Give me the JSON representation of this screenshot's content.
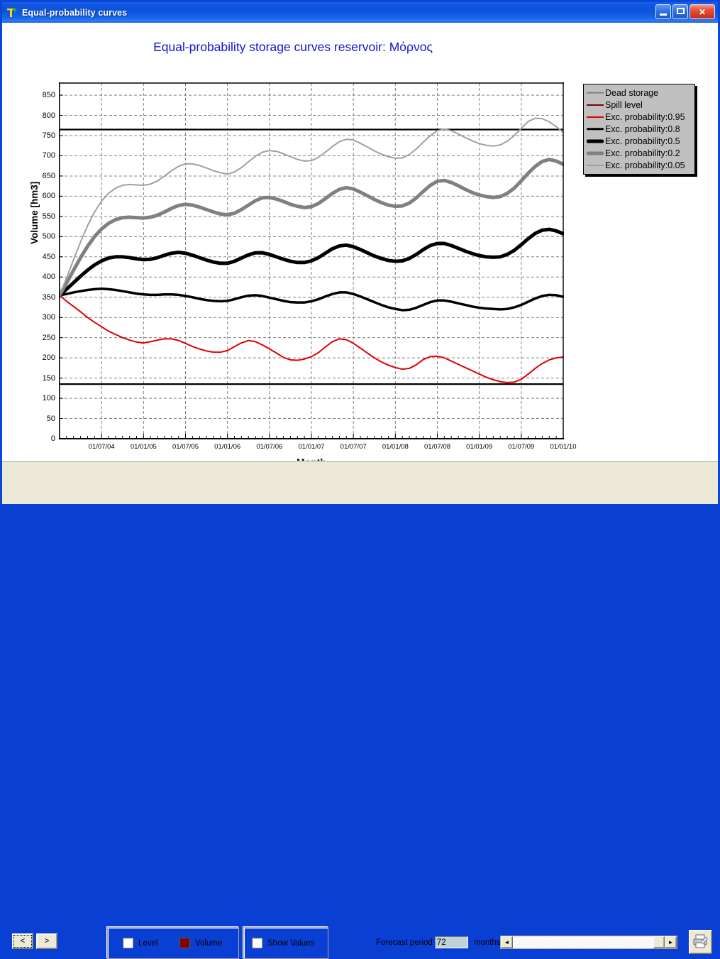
{
  "window": {
    "title": "Equal-probability curves",
    "app_icon": "hydronomeas-icon",
    "controls": {
      "minimize": "minimize-button",
      "maximize": "maximize-button",
      "close_label": "✕"
    }
  },
  "chart_data": {
    "type": "line",
    "title": "Equal-probability storage curves reservoir: Μόρνος",
    "xlabel": "Month",
    "ylabel": "Volume [hm3]",
    "grid": true,
    "legend_position": "top-right",
    "ylim": [
      0,
      880
    ],
    "yticks": [
      0,
      50,
      100,
      150,
      200,
      250,
      300,
      350,
      400,
      450,
      500,
      550,
      600,
      650,
      700,
      750,
      800,
      850
    ],
    "xticks": [
      "01/07/04",
      "01/01/05",
      "01/07/05",
      "01/01/06",
      "01/07/06",
      "01/01/07",
      "01/07/07",
      "01/01/08",
      "01/07/08",
      "01/01/09",
      "01/07/09",
      "01/01/10"
    ],
    "x_start": "01/01/04",
    "x_end": "01/01/10",
    "n_points": 73,
    "reference_lines": [
      {
        "name": "Spill level",
        "value": 765,
        "color": "#000000",
        "width": 2.2
      },
      {
        "name": "Dead storage",
        "value": 135,
        "color": "#000000",
        "width": 2.2
      }
    ],
    "series": [
      {
        "name": "Dead storage",
        "legend_color": "#808080",
        "legend_width": 2.5,
        "is_reference": true
      },
      {
        "name": "Spill level",
        "legend_color": "#800000",
        "legend_width": 2.0,
        "is_reference": true
      },
      {
        "name": "Exc. probability:0.95",
        "color": "#e00000",
        "width": 2.0,
        "values": [
          355,
          340,
          327,
          314,
          300,
          288,
          277,
          266,
          258,
          250,
          244,
          239,
          237,
          240,
          244,
          247,
          247,
          243,
          236,
          228,
          222,
          217,
          214,
          214,
          218,
          228,
          237,
          243,
          240,
          232,
          222,
          212,
          201,
          195,
          194,
          197,
          203,
          213,
          227,
          240,
          247,
          245,
          236,
          224,
          212,
          200,
          190,
          182,
          176,
          172,
          174,
          183,
          196,
          203,
          204,
          200,
          192,
          184,
          176,
          168,
          160,
          152,
          146,
          141,
          139,
          140,
          147,
          160,
          174,
          186,
          195,
          200,
          202
        ]
      },
      {
        "name": "Exc. probability:0.8",
        "color": "#000000",
        "width": 3.5,
        "values": [
          355,
          358,
          362,
          365,
          368,
          370,
          371,
          370,
          368,
          365,
          362,
          359,
          357,
          356,
          356,
          357,
          357,
          356,
          353,
          350,
          346,
          343,
          341,
          340,
          341,
          345,
          350,
          354,
          355,
          353,
          349,
          345,
          341,
          338,
          337,
          337,
          340,
          345,
          352,
          358,
          362,
          362,
          358,
          352,
          345,
          338,
          331,
          325,
          321,
          318,
          319,
          324,
          331,
          338,
          342,
          342,
          339,
          335,
          331,
          327,
          324,
          322,
          321,
          320,
          321,
          325,
          331,
          339,
          347,
          353,
          356,
          355,
          351
        ]
      },
      {
        "name": "Exc. probability:0.5",
        "color": "#000000",
        "width": 5.0,
        "values": [
          355,
          370,
          386,
          402,
          417,
          430,
          440,
          447,
          450,
          450,
          448,
          445,
          443,
          444,
          448,
          454,
          459,
          461,
          459,
          454,
          448,
          442,
          437,
          434,
          434,
          439,
          447,
          455,
          460,
          460,
          456,
          450,
          444,
          439,
          436,
          436,
          440,
          448,
          459,
          470,
          477,
          479,
          475,
          468,
          460,
          452,
          446,
          441,
          439,
          440,
          446,
          456,
          468,
          478,
          483,
          483,
          478,
          471,
          464,
          458,
          453,
          450,
          449,
          450,
          456,
          466,
          480,
          495,
          508,
          516,
          518,
          514,
          507
        ]
      },
      {
        "name": "Exc. probability:0.2",
        "color": "#808080",
        "width": 5.0,
        "values": [
          355,
          385,
          417,
          448,
          476,
          500,
          519,
          533,
          542,
          547,
          548,
          547,
          546,
          548,
          553,
          561,
          570,
          577,
          580,
          578,
          573,
          567,
          561,
          556,
          554,
          558,
          567,
          578,
          589,
          596,
          597,
          593,
          587,
          580,
          575,
          572,
          574,
          582,
          594,
          607,
          617,
          621,
          618,
          610,
          601,
          592,
          584,
          578,
          575,
          576,
          583,
          596,
          612,
          627,
          637,
          639,
          634,
          626,
          617,
          609,
          603,
          599,
          597,
          599,
          607,
          620,
          638,
          657,
          674,
          686,
          691,
          687,
          679
        ]
      },
      {
        "name": "Exc. probability:0.05",
        "color": "#a0a0a0",
        "width": 2.0,
        "values": [
          355,
          398,
          443,
          487,
          527,
          561,
          588,
          607,
          620,
          627,
          629,
          628,
          627,
          630,
          638,
          650,
          663,
          674,
          680,
          680,
          676,
          670,
          663,
          658,
          655,
          660,
          671,
          685,
          699,
          709,
          713,
          711,
          705,
          698,
          691,
          687,
          688,
          696,
          709,
          723,
          735,
          741,
          739,
          731,
          722,
          712,
          704,
          698,
          694,
          695,
          703,
          717,
          734,
          750,
          762,
          766,
          762,
          754,
          745,
          737,
          730,
          726,
          724,
          727,
          736,
          750,
          768,
          785,
          793,
          792,
          784,
          772,
          758
        ]
      }
    ]
  },
  "legend": {
    "items": [
      {
        "label": "Dead storage",
        "color": "#808080",
        "width": 2.5
      },
      {
        "label": "Spill level",
        "color": "#800000",
        "width": 2.0
      },
      {
        "label": "Exc. probability:0.95",
        "color": "#e00000",
        "width": 2.0
      },
      {
        "label": "Exc. probability:0.8",
        "color": "#000000",
        "width": 3.5
      },
      {
        "label": "Exc. probability:0.5",
        "color": "#000000",
        "width": 5.0
      },
      {
        "label": "Exc. probability:0.2",
        "color": "#808080",
        "width": 5.0
      },
      {
        "label": "Exc. probability:0.05",
        "color": "#a0a0a0",
        "width": 2.0
      }
    ]
  },
  "toolbar": {
    "prev_label": "<",
    "next_label": ">",
    "level_label": "Level",
    "level_checked": false,
    "volume_label": "Volume",
    "volume_checked": true,
    "volume_color": "#7f0000",
    "show_values_label": "Show Values",
    "show_values_checked": false,
    "forecast_label": "Forecast period",
    "forecast_value": "72",
    "forecast_unit": "months",
    "scroll_left_glyph": "◄",
    "scroll_right_glyph": "►",
    "print_icon": "printer-icon"
  }
}
